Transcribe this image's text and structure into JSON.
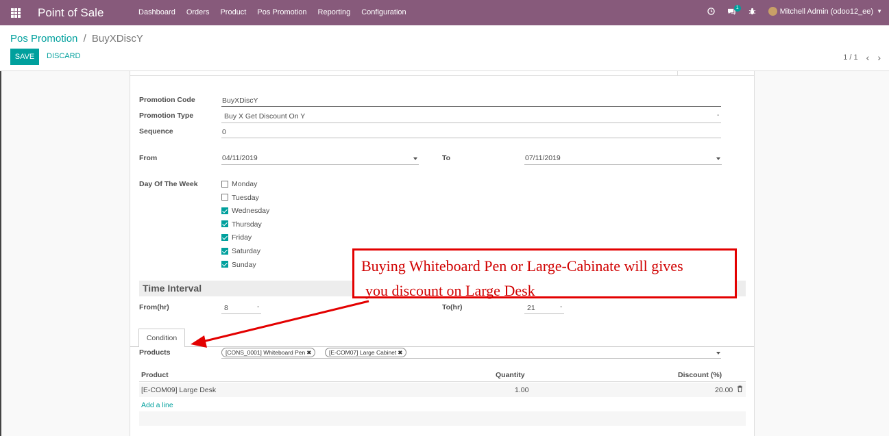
{
  "navbar": {
    "brand": "Point of Sale",
    "menu": [
      "Dashboard",
      "Orders",
      "Product",
      "Pos Promotion",
      "Reporting",
      "Configuration"
    ],
    "chat_badge": "1",
    "user": "Mitchell Admin (odoo12_ee)"
  },
  "control": {
    "breadcrumb_parent": "Pos Promotion",
    "breadcrumb_sep": "/",
    "breadcrumb_current": "BuyXDiscY",
    "save_label": "SAVE",
    "discard_label": "DISCARD",
    "pager": "1 / 1"
  },
  "form": {
    "promotion_code_label": "Promotion Code",
    "promotion_code": "BuyXDiscY",
    "promotion_type_label": "Promotion Type",
    "promotion_type": "Buy X Get Discount On Y",
    "sequence_label": "Sequence",
    "sequence": "0",
    "from_label": "From",
    "from_date": "04/11/2019",
    "to_label": "To",
    "to_date": "07/11/2019",
    "day_of_week_label": "Day Of The Week",
    "days": [
      {
        "label": "Monday",
        "checked": false
      },
      {
        "label": "Tuesday",
        "checked": false
      },
      {
        "label": "Wednesday",
        "checked": true
      },
      {
        "label": "Thursday",
        "checked": true
      },
      {
        "label": "Friday",
        "checked": true
      },
      {
        "label": "Saturday",
        "checked": true
      },
      {
        "label": "Sunday",
        "checked": true
      }
    ],
    "time_interval_title": "Time Interval",
    "from_hr_label": "From(hr)",
    "from_hr": "8",
    "to_hr_label": "To(hr)",
    "to_hr": "21"
  },
  "tabs": {
    "condition": "Condition"
  },
  "condition": {
    "products_label": "Products",
    "product_tags": [
      "[CONS_0001] Whiteboard Pen",
      "[E-COM07] Large Cabinet"
    ],
    "table_headers": {
      "product": "Product",
      "quantity": "Quantity",
      "discount": "Discount (%)"
    },
    "rows": [
      {
        "product": "[E-COM09] Large Desk",
        "quantity": "1.00",
        "discount": "20.00"
      }
    ],
    "add_line": "Add a line"
  },
  "annotation": {
    "line1": "Buying Whiteboard Pen or Large-Cabinate will gives",
    "line2": "you discount on Large Desk",
    "color": "#e30000"
  },
  "colors": {
    "navbar": "#875a7b",
    "accent": "#00a09d"
  }
}
